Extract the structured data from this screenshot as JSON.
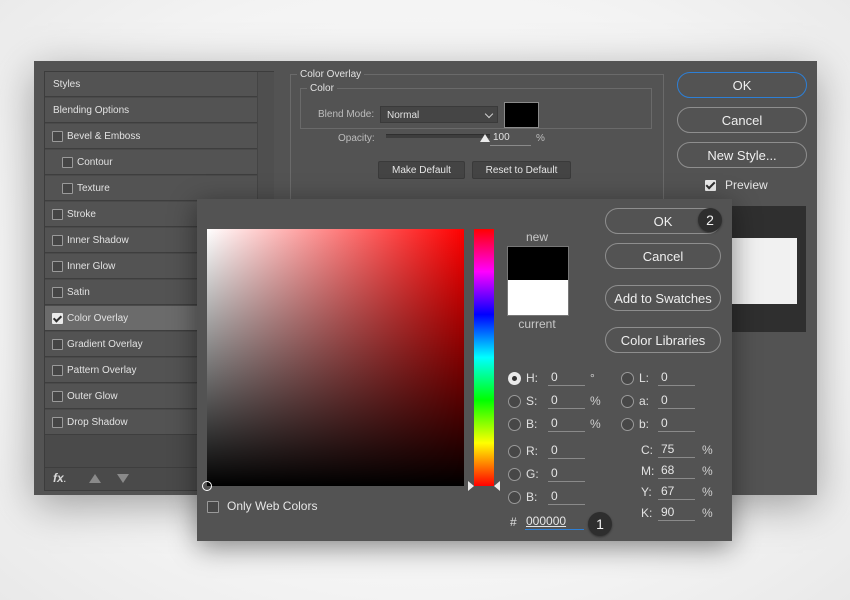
{
  "layer_style": {
    "styles": [
      {
        "label": "Styles",
        "checkbox": false,
        "checked": false,
        "indent": 0,
        "selected": false
      },
      {
        "label": "Blending Options",
        "checkbox": false,
        "checked": false,
        "indent": 0,
        "selected": false
      },
      {
        "label": "Bevel & Emboss",
        "checkbox": true,
        "checked": false,
        "indent": 0,
        "selected": false
      },
      {
        "label": "Contour",
        "checkbox": true,
        "checked": false,
        "indent": 1,
        "selected": false
      },
      {
        "label": "Texture",
        "checkbox": true,
        "checked": false,
        "indent": 1,
        "selected": false
      },
      {
        "label": "Stroke",
        "checkbox": true,
        "checked": false,
        "indent": 0,
        "selected": false
      },
      {
        "label": "Inner Shadow",
        "checkbox": true,
        "checked": false,
        "indent": 0,
        "selected": false
      },
      {
        "label": "Inner Glow",
        "checkbox": true,
        "checked": false,
        "indent": 0,
        "selected": false
      },
      {
        "label": "Satin",
        "checkbox": true,
        "checked": false,
        "indent": 0,
        "selected": false
      },
      {
        "label": "Color Overlay",
        "checkbox": true,
        "checked": true,
        "indent": 0,
        "selected": true
      },
      {
        "label": "Gradient Overlay",
        "checkbox": true,
        "checked": false,
        "indent": 0,
        "selected": false
      },
      {
        "label": "Pattern Overlay",
        "checkbox": true,
        "checked": false,
        "indent": 0,
        "selected": false
      },
      {
        "label": "Outer Glow",
        "checkbox": true,
        "checked": false,
        "indent": 0,
        "selected": false
      },
      {
        "label": "Drop Shadow",
        "checkbox": true,
        "checked": false,
        "indent": 0,
        "selected": false
      }
    ],
    "footer": {
      "fx_label": "fx",
      "fx_suffix": "."
    },
    "overlay_group_title": "Color Overlay",
    "color_group_title": "Color",
    "blend_mode_label": "Blend Mode:",
    "blend_mode_value": "Normal",
    "overlay_color": "#000000",
    "opacity_label": "Opacity:",
    "opacity_value": "100",
    "opacity_percent": 100,
    "opacity_unit": "%",
    "make_default_label": "Make Default",
    "reset_default_label": "Reset to Default",
    "ok_label": "OK",
    "cancel_label": "Cancel",
    "new_style_label": "New Style...",
    "preview_label": "Preview",
    "preview_checked": true
  },
  "color_picker": {
    "ok_label": "OK",
    "cancel_label": "Cancel",
    "add_swatches_label": "Add to Swatches",
    "color_libraries_label": "Color Libraries",
    "new_label": "new",
    "current_label": "current",
    "new_color": "#000000",
    "current_color": "#FFFFFF",
    "only_web_colors_label": "Only Web Colors",
    "only_web_colors_checked": false,
    "hsb": [
      {
        "label": "H:",
        "value": "0",
        "unit": "°",
        "selected": true
      },
      {
        "label": "S:",
        "value": "0",
        "unit": "%",
        "selected": false
      },
      {
        "label": "B:",
        "value": "0",
        "unit": "%",
        "selected": false
      }
    ],
    "rgb": [
      {
        "label": "R:",
        "value": "0"
      },
      {
        "label": "G:",
        "value": "0"
      },
      {
        "label": "B:",
        "value": "0"
      }
    ],
    "lab": [
      {
        "label": "L:",
        "value": "0"
      },
      {
        "label": "a:",
        "value": "0"
      },
      {
        "label": "b:",
        "value": "0"
      }
    ],
    "cmyk": [
      {
        "label": "C:",
        "value": "75",
        "unit": "%"
      },
      {
        "label": "M:",
        "value": "68",
        "unit": "%"
      },
      {
        "label": "Y:",
        "value": "67",
        "unit": "%"
      },
      {
        "label": "K:",
        "value": "90",
        "unit": "%"
      }
    ],
    "hex_label": "#",
    "hex_value": "000000"
  },
  "callouts": {
    "hex": "1",
    "ok": "2"
  },
  "colors": {
    "accent": "#2d7fd6",
    "panel": "#535353"
  }
}
